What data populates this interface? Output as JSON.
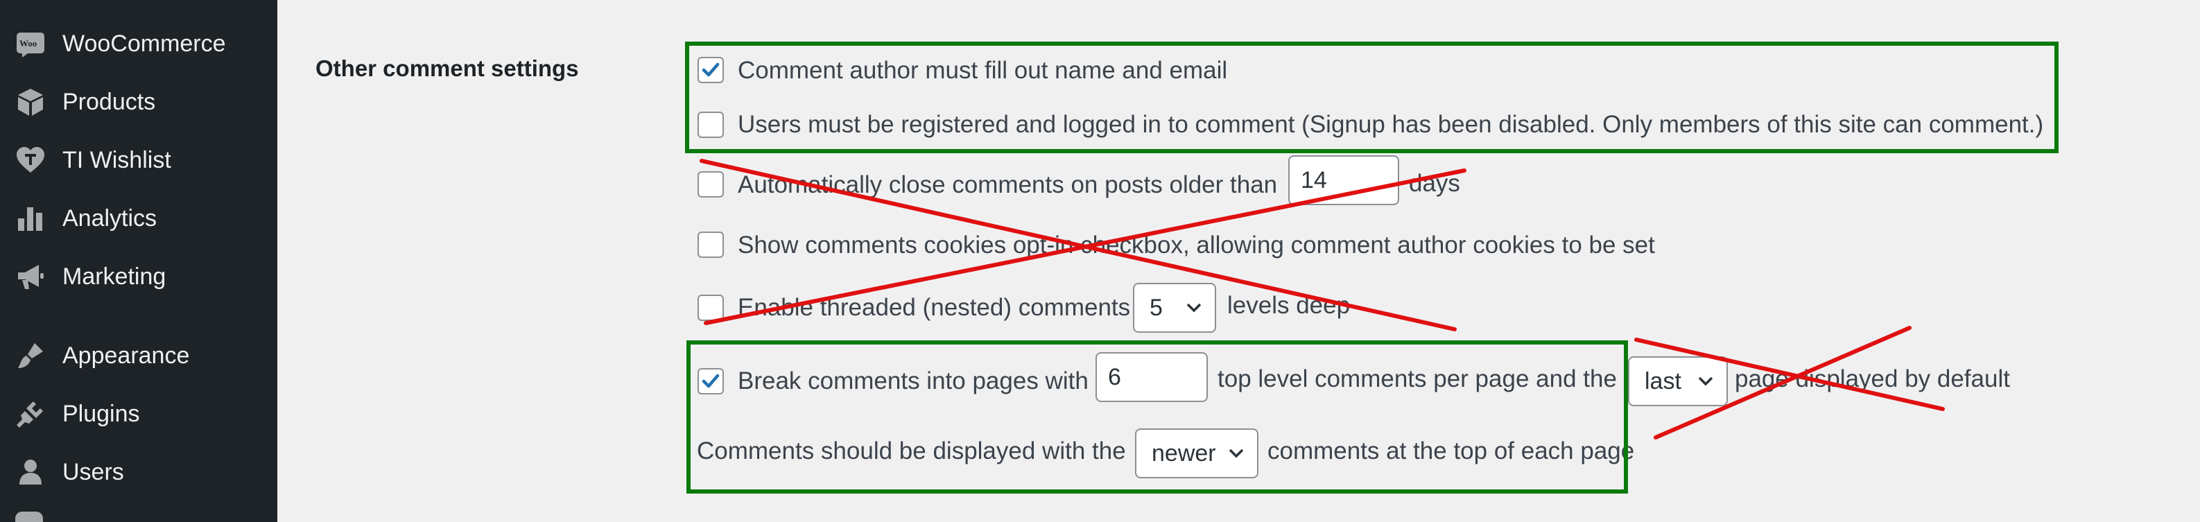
{
  "sidebar": {
    "items": [
      {
        "label": "WooCommerce",
        "icon": "woocommerce-icon"
      },
      {
        "label": "Products",
        "icon": "box-icon"
      },
      {
        "label": "TI Wishlist",
        "icon": "heart-icon"
      },
      {
        "label": "Analytics",
        "icon": "bar-chart-icon"
      },
      {
        "label": "Marketing",
        "icon": "megaphone-icon"
      },
      {
        "label": "Appearance",
        "icon": "paintbrush-icon"
      },
      {
        "label": "Plugins",
        "icon": "plug-icon"
      },
      {
        "label": "Users",
        "icon": "user-icon"
      }
    ],
    "woo_badge": "Woo"
  },
  "settings": {
    "section_label": "Other comment settings",
    "require_name_email": {
      "label": "Comment author must fill out name and email",
      "checked": true
    },
    "registration_required": {
      "label": "Users must be registered and logged in to comment (Signup has been disabled. Only members of this site can comment.)",
      "checked": false
    },
    "close_comments": {
      "label": "Automatically close comments on posts older than",
      "value": "14",
      "suffix": "days",
      "checked": false
    },
    "cookies_opt_in": {
      "label": "Show comments cookies opt-in checkbox, allowing comment author cookies to be set",
      "checked": false
    },
    "thread_comments": {
      "label": "Enable threaded (nested) comments",
      "value": "5",
      "suffix": "levels deep",
      "checked": false
    },
    "page_comments": {
      "label": "Break comments into pages with",
      "value": "6",
      "middle": "top level comments per page and the",
      "page_select": "last",
      "suffix": "page displayed by default",
      "checked": true
    },
    "comment_order": {
      "prefix": "Comments should be displayed with the",
      "value": "newer",
      "suffix": "comments at the top of each page"
    }
  },
  "annotations": {
    "box_color": "#0a7a0a",
    "cross_color": "#e01010"
  },
  "colors": {
    "sidebar_bg": "#1d2327",
    "page_bg": "#f0f0f1",
    "checkbox_blue": "#2271b1"
  }
}
